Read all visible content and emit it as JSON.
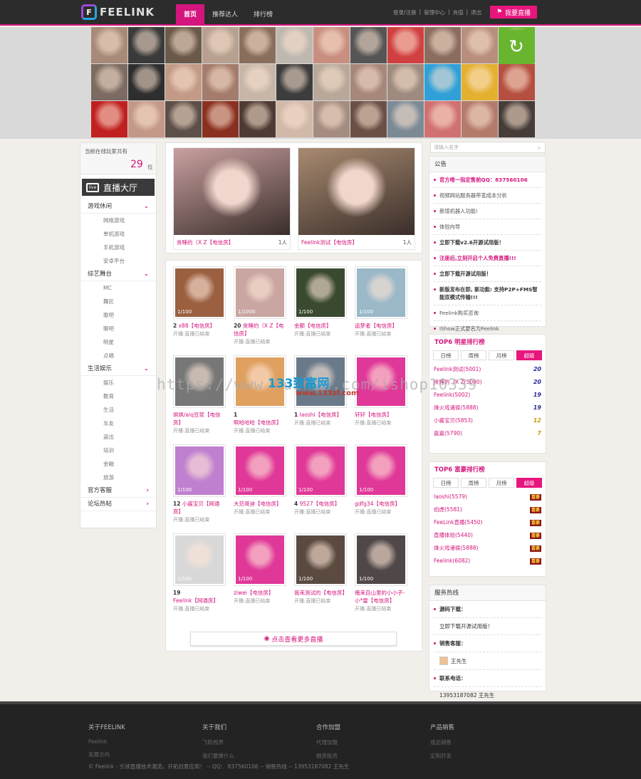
{
  "header": {
    "logo_text": "FEELINK",
    "logo_mark": "F",
    "nav": [
      "首页",
      "推荐达人",
      "排行榜"
    ],
    "links": [
      "登录/注册",
      "|",
      "管理中心",
      "|",
      "充值",
      "|",
      "退出"
    ],
    "live_button": "我要直播",
    "live_icon": "map-pin-icon"
  },
  "banner": {
    "tile_colors": [
      "#a88a78",
      "#3a3a3a",
      "#6b5a4a",
      "#b7a08f",
      "#8a6e5c",
      "#bfb8b0",
      "#c88f80",
      "#555",
      "#d04040",
      "#8b6d60",
      "#b78f7c",
      "#69b530",
      "#7c6b62",
      "#2e2e2e",
      "#c29a86",
      "#a47c6c",
      "#c7b6a8",
      "#3d3d3d",
      "#b8a89a",
      "#a6877a",
      "#9e8a7e",
      "#30a0d8",
      "#e3b030",
      "#b55040",
      "#c02020",
      "#c39886",
      "#5c4e48",
      "#8a3020",
      "#4e3c34",
      "#d1b8a8",
      "#a58c80",
      "#6a5046",
      "#7c8a96",
      "#d07070",
      "#b37b6a",
      "#463c38"
    ],
    "refresh_icon": "refresh-icon"
  },
  "left": {
    "online_label": "当前在线玩家共有",
    "online_count": "29",
    "online_unit": "位",
    "hall_title": "直播大厅",
    "hall_icon_text": "live",
    "categories": [
      {
        "label": "游戏休闲",
        "items": [
          "网络游戏",
          "单机游戏",
          "手机游戏",
          "安卓平台"
        ]
      },
      {
        "label": "综艺舞台",
        "items": [
          "MC",
          "舞区",
          "歌吧",
          "聊吧",
          "明星",
          "点唱"
        ]
      },
      {
        "label": "生活娱乐",
        "items": [
          "娱乐",
          "教育",
          "生活",
          "车友",
          "盗出",
          "培训",
          "金融",
          "旅游"
        ]
      }
    ],
    "extra": [
      "官方客服",
      "论坛热帖"
    ]
  },
  "featured": [
    {
      "name": "贪睡的（X Z【电信房】",
      "count": "1人",
      "color": "#c9a0a0"
    },
    {
      "name": "Feelink测试【电信房】",
      "count": "1人",
      "color": "#a88a70"
    }
  ],
  "rooms": [
    {
      "count": "1/100",
      "level": "2",
      "name": "x88【电信房】",
      "status": "开播:直播已结束",
      "color": "#9a6040"
    },
    {
      "count": "1/1000",
      "level": "20",
      "name": "贪睡的（X Z【电信房】",
      "status": "开播:直播已结束",
      "color": "#c9a6a2"
    },
    {
      "count": "1/100",
      "level": "",
      "name": "金额【电信房】",
      "status": "开播:直播已结束",
      "color": "#3a4a30"
    },
    {
      "count": "1/100",
      "level": "",
      "name": "追梦者【电信房】",
      "status": "开播:直播已结束",
      "color": "#9ab8c8"
    },
    {
      "count": "",
      "level": "",
      "name": "飒飒/aiq豆浆【电信房】",
      "status": "开播:直播已结束",
      "color": "#777"
    },
    {
      "count": "",
      "level": "1",
      "name": "啊哈哈哈【电信房】",
      "status": "开播:直播已结束",
      "color": "#e0a060"
    },
    {
      "count": "",
      "level": "1",
      "name": "laoshi【电信房】",
      "status": "开播:直播已结束",
      "color": "#6a7a8a"
    },
    {
      "count": "",
      "level": "",
      "name": "轩轩【电信房】",
      "status": "开播:直播已结束",
      "color": "#e03898"
    },
    {
      "count": "1/100",
      "level": "12",
      "name": "小酱宝贝【网通房】",
      "status": "开播:直播已结束",
      "color": "#c080d0"
    },
    {
      "count": "1/100",
      "level": "",
      "name": "大范哥迪【电信房】",
      "status": "开播:直播已结束",
      "color": "#e03898"
    },
    {
      "count": "1/100",
      "level": "4",
      "name": "9527【电信房】",
      "status": "开播:直播已结束",
      "color": "#e03898"
    },
    {
      "count": "1/100",
      "level": "",
      "name": "gdfg34【电信房】",
      "status": "开播:直播已结束",
      "color": "#e03898"
    },
    {
      "count": "1/100",
      "level": "19",
      "name": "Feelink【网通房】",
      "status": "开播:直播已结束",
      "color": "#d8d8d8"
    },
    {
      "count": "1/100",
      "level": "",
      "name": "ziwei【电信房】",
      "status": "开播:直播已结束",
      "color": "#e03898"
    },
    {
      "count": "1/100",
      "level": "",
      "name": "我来测试的【电信房】",
      "status": "开播:直播已结束",
      "color": "#5a4a40"
    },
    {
      "count": "1/100",
      "level": "",
      "name": "俺来自山里的小小子-小*雷【电信房】",
      "status": "开播:直播已结束",
      "color": "#504848"
    }
  ],
  "more_label": "点击查看更多直播",
  "right": {
    "search_placeholder": "请输入名字",
    "notice_title": "公告",
    "notices": [
      {
        "text": "官方唯一指定售前QQ：837560106",
        "style": "red"
      },
      {
        "text": "视频网站服务器带宽成本分析",
        "style": ""
      },
      {
        "text": "新增机器人功能!",
        "style": ""
      },
      {
        "text": "体验向导",
        "style": ""
      },
      {
        "text": "立即下载v2.6开源试用版！",
        "style": "bold"
      },
      {
        "text": "注册后,立刻开启个人免费直播!!!",
        "style": "red"
      },
      {
        "text": "立即下载开源试用版！",
        "style": "bold"
      },
      {
        "text": "新版发布在即, 新功能: 支持P2P+FMS智能双模式传输!!!",
        "style": "bold"
      },
      {
        "text": "Feelink购买咨询",
        "style": ""
      },
      {
        "text": "iShow正式更名为Feelink",
        "style": ""
      }
    ],
    "star_title": "TOP6 明星排行榜",
    "star_tabs": [
      "日榜",
      "周榜",
      "月榜",
      "超级"
    ],
    "stars": [
      {
        "name": "Feelink测试(5001)",
        "badge": "20"
      },
      {
        "name": "贪睡的（X Z(5000)",
        "badge": "20"
      },
      {
        "name": "Feelink(5002)",
        "badge": "19"
      },
      {
        "name": "烽火戏诸侯(5888)",
        "badge": "19"
      },
      {
        "name": "小酱宝贝(5853)",
        "badge": "12"
      },
      {
        "name": "嘉嘉(5790)",
        "badge": "7"
      }
    ],
    "rich_title": "TOP6 富豪排行榜",
    "rich_tabs": [
      "日榜",
      "周榜",
      "月榜",
      "超级"
    ],
    "rich": [
      {
        "name": "laoshi(5579)",
        "badge": "富豪"
      },
      {
        "name": "伯虎(5581)",
        "badge": "富豪"
      },
      {
        "name": "FeeLink直播(5450)",
        "badge": "富豪"
      },
      {
        "name": "直播体验(5440)",
        "badge": "富豪"
      },
      {
        "name": "烽火戏诸侯(5888)",
        "badge": "富豪"
      },
      {
        "name": "Feelink(6082)",
        "badge": "富豪"
      }
    ],
    "service_title": "服务热线",
    "service": {
      "download_label": "源码下载：",
      "download_value": "立即下载开源试用版！",
      "sales_label": "销售客服：",
      "sales_value": "王先生",
      "phone_label": "联系电话：",
      "phone_value": "13953187082 王先生"
    }
  },
  "footer": {
    "cols": [
      {
        "head": "关于FEELINK",
        "links": [
          "Feelink",
          "发展方向"
        ]
      },
      {
        "head": "关于我们",
        "links": [
          "飞聆视界",
          "我们要做什么"
        ]
      },
      {
        "head": "合作加盟",
        "links": [
          "代理加盟",
          "融资投资"
        ]
      },
      {
        "head": "产品销售",
        "links": [
          "成品销售",
          "定制开发"
        ]
      }
    ],
    "copyright": "© Feelink - 引领直播技术潮流，开拓创意应用！ -- QQ： 837560106 -- 销售热线 -- 13953187082 王先生"
  },
  "watermark": {
    "text": "https://www.huzhan.com/ishop10339",
    "logo": "133致富网",
    "url": "www.133zf.com"
  }
}
